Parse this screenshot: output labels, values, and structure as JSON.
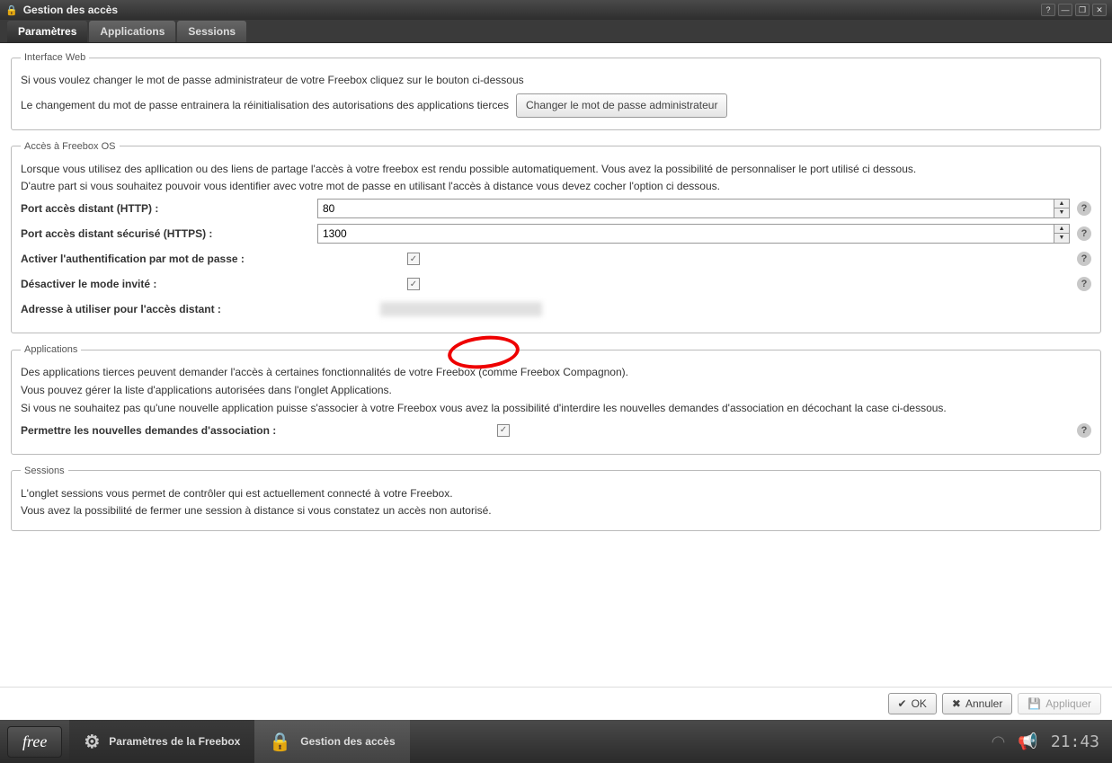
{
  "window": {
    "title": "Gestion des accès"
  },
  "tabs": [
    "Paramètres",
    "Applications",
    "Sessions"
  ],
  "interfaceWeb": {
    "legend": "Interface Web",
    "line1": "Si vous voulez changer le mot de passe administrateur de votre Freebox cliquez sur le bouton ci-dessous",
    "line2": "Le changement du mot de passe entrainera la réinitialisation des autorisations des applications tierces",
    "button": "Changer le mot de passe administrateur"
  },
  "access": {
    "legend": "Accès à Freebox OS",
    "line1": "Lorsque vous utilisez des apllication ou des liens de partage l'accès à votre freebox est rendu possible automatiquement. Vous avez la possibilité de personnaliser le port utilisé ci dessous.",
    "line2": "D'autre part si vous souhaitez pouvoir vous identifier avec votre mot de passe en utilisant l'accès à distance vous devez cocher l'option ci dessous.",
    "httpLabel": "Port accès distant (HTTP) :",
    "httpValue": "80",
    "httpsLabel": "Port accès distant sécurisé (HTTPS) :",
    "httpsValue": "1300",
    "authLabel": "Activer l'authentification par mot de passe :",
    "authChecked": true,
    "guestLabel": "Désactiver le mode invité :",
    "guestChecked": true,
    "addressLabel": "Adresse à utiliser pour l'accès distant :"
  },
  "applications": {
    "legend": "Applications",
    "line1": "Des applications tierces peuvent demander l'accès à certaines fonctionnalités de votre Freebox (comme Freebox Compagnon).",
    "line2": "Vous pouvez gérer la liste d'applications autorisées dans l'onglet Applications.",
    "line3": "Si vous ne souhaitez pas qu'une nouvelle application puisse s'associer à votre Freebox vous avez la possibilité d'interdire les nouvelles demandes d'association en décochant la case ci-dessous.",
    "allowLabel": "Permettre les nouvelles demandes d'association :",
    "allowChecked": true
  },
  "sessions": {
    "legend": "Sessions",
    "line1": "L'onglet sessions vous permet de contrôler qui est actuellement connecté à votre Freebox.",
    "line2": "Vous avez la possibilité de fermer une session à distance si vous constatez un accès non autorisé."
  },
  "footer": {
    "ok": "OK",
    "cancel": "Annuler",
    "apply": "Appliquer"
  },
  "taskbar": {
    "free": "free",
    "settings": "Paramètres de la Freebox",
    "access": "Gestion des accès",
    "clock": "21:43"
  },
  "help": "?"
}
